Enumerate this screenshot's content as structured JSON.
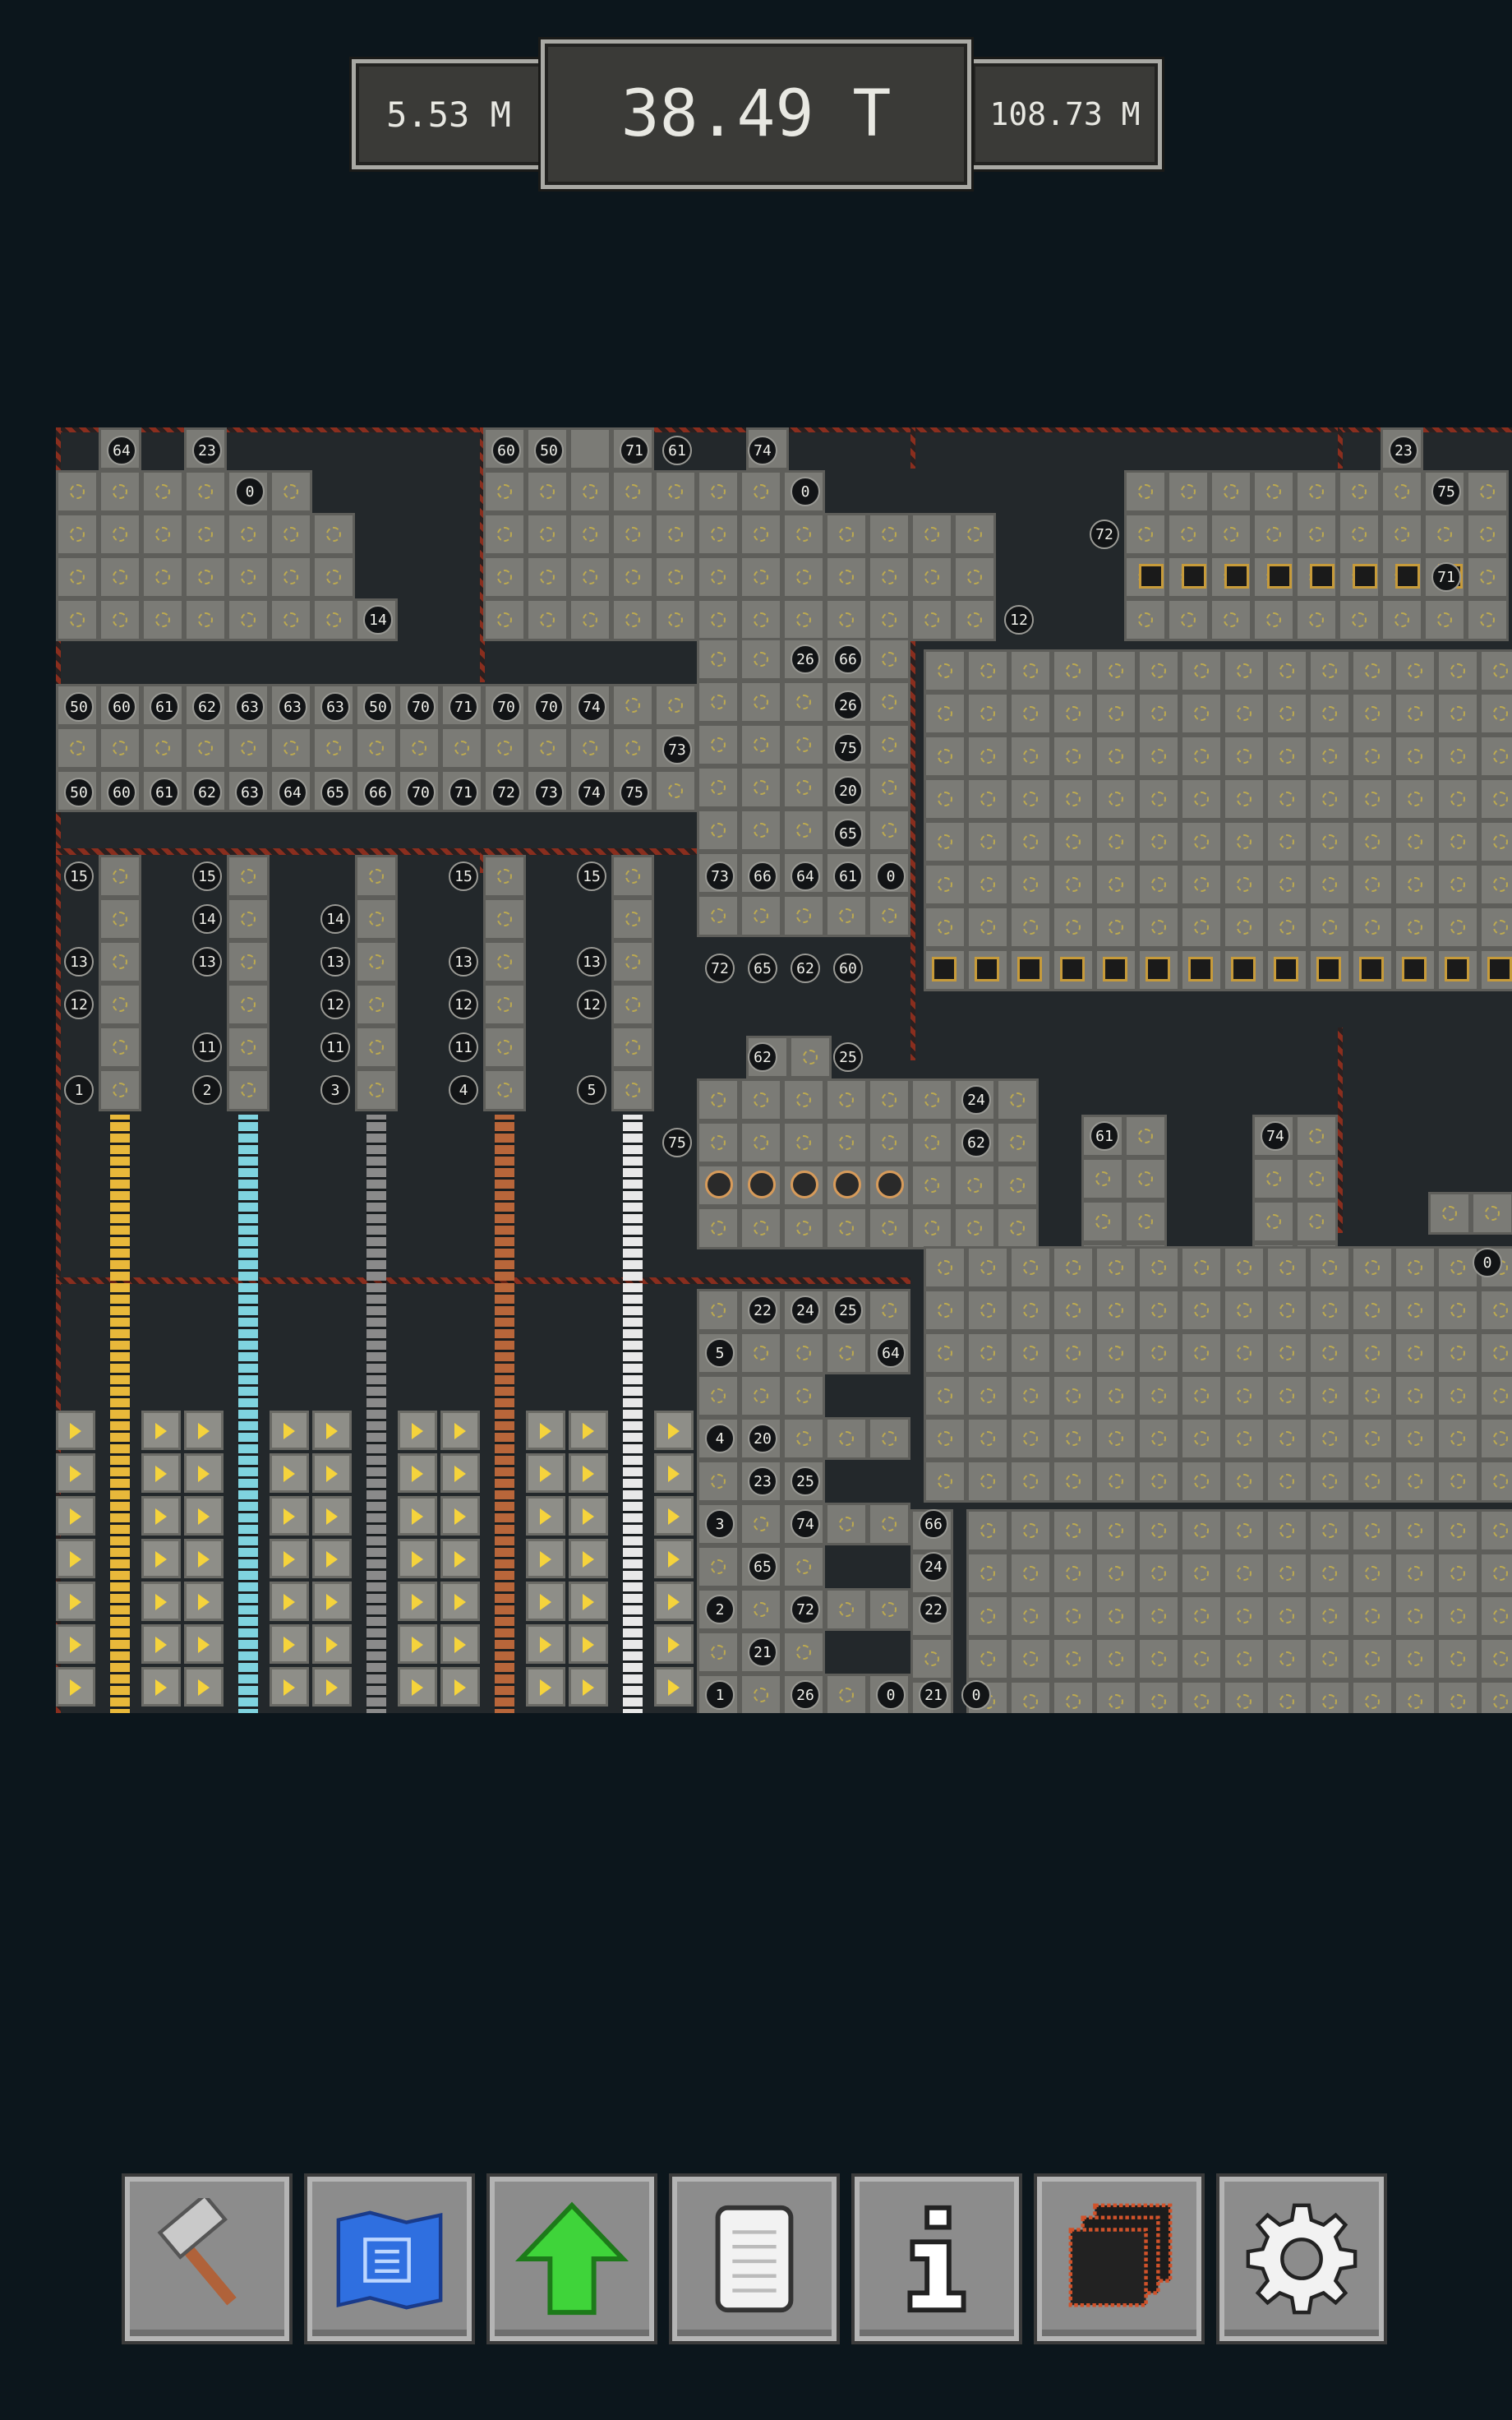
{
  "stats": {
    "left_value": "5.53 M",
    "main_value": "38.49 T",
    "right_value": "108.73 M"
  },
  "map": {
    "labels_top_row": [
      "64",
      "23",
      "60",
      "50",
      "71",
      "61",
      "74",
      "23"
    ],
    "labels_row_sorter_top": [
      "50",
      "60",
      "61",
      "62",
      "63",
      "63",
      "63",
      "50",
      "70",
      "71",
      "70",
      "70",
      "74"
    ],
    "labels_row_sorter_bottom": [
      "50",
      "60",
      "61",
      "62",
      "63",
      "64",
      "65",
      "66",
      "70",
      "71",
      "72",
      "73",
      "74",
      "75"
    ],
    "labels_misc": [
      "0",
      "0",
      "14",
      "12",
      "72",
      "75",
      "71",
      "73",
      "26",
      "66",
      "26",
      "75",
      "20",
      "65",
      "73",
      "66",
      "64",
      "61",
      "0",
      "72",
      "65",
      "62",
      "60",
      "62",
      "25",
      "24",
      "75",
      "62",
      "61",
      "74",
      "0",
      "22",
      "24",
      "25",
      "5",
      "64",
      "4",
      "20",
      "23",
      "25",
      "3",
      "74",
      "65",
      "2",
      "72",
      "21",
      "1",
      "26",
      "0",
      "21",
      "0",
      "66",
      "24",
      "22"
    ],
    "column_labels": [
      [
        "15",
        "13",
        "12",
        "1"
      ],
      [
        "15",
        "14",
        "13",
        "11",
        "2"
      ],
      [
        "14",
        "13",
        "12",
        "11",
        "3"
      ],
      [
        "15",
        "13",
        "12",
        "11",
        "4"
      ],
      [
        "15",
        "13",
        "12",
        "5"
      ]
    ],
    "resource_colors": [
      "#e8b83a",
      "#7fd3df",
      "#8a8a8a",
      "#b8663a",
      "#e8e8e8"
    ]
  },
  "toolbar": [
    {
      "name": "build",
      "icon": "hammer-icon"
    },
    {
      "name": "blueprint",
      "icon": "blueprint-icon"
    },
    {
      "name": "upgrade",
      "icon": "upgrade-arrow-icon"
    },
    {
      "name": "notes",
      "icon": "notes-icon"
    },
    {
      "name": "info",
      "icon": "info-icon"
    },
    {
      "name": "layers",
      "icon": "layers-icon"
    },
    {
      "name": "settings",
      "icon": "gear-icon"
    }
  ]
}
